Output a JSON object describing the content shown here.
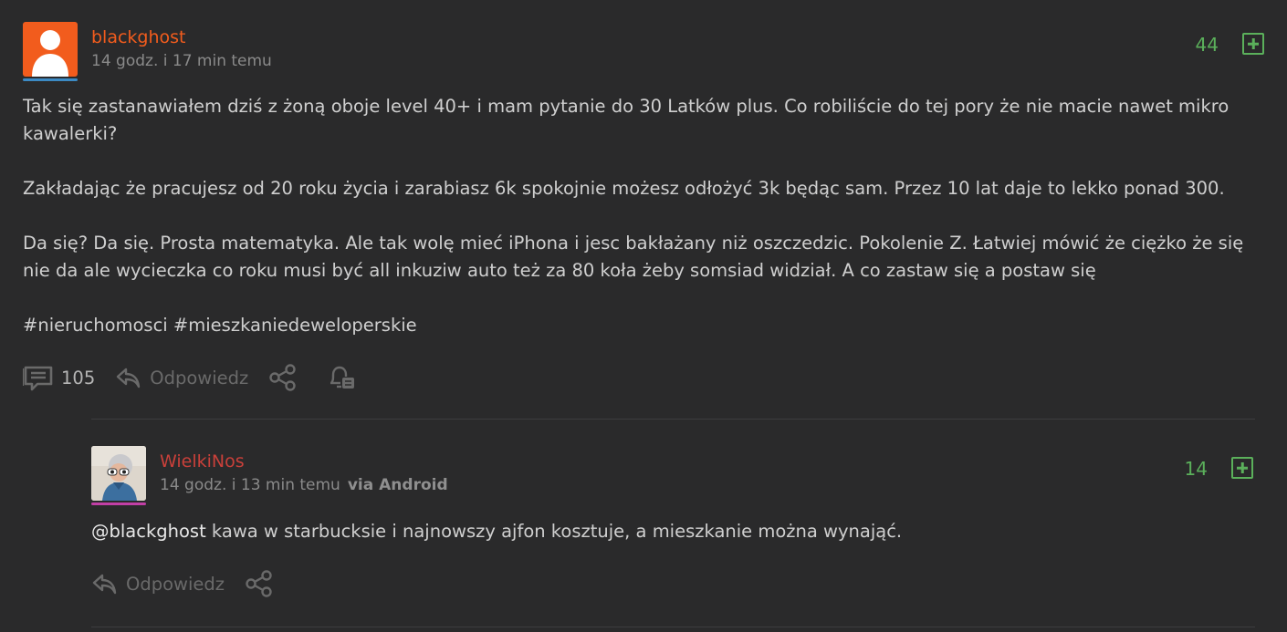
{
  "post": {
    "author": "blackghost",
    "author_color": "#f25c1d",
    "avatar_bar_color": "#3c8ac4",
    "timestamp": "14 godz. i 17 min temu",
    "votes": "44",
    "paragraphs": [
      "Tak się zastanawiałem dziś z żoną oboje level 40+ i mam pytanie do 30 Latków plus. Co robiliście do tej pory że nie macie nawet mikro kawalerki?",
      "",
      "Zakładając że pracujesz od 20 roku życia i zarabiasz 6k spokojnie możesz odłożyć 3k będąc sam. Przez 10 lat daje to lekko ponad 300.",
      "",
      "Da się? Da się. Prosta matematyka. Ale tak wolę mieć iPhona i jesc bakłażany niż oszczedzic. Pokolenie Z. Łatwiej mówić że ciężko że się nie da ale wycieczka co roku musi być all inkuziw auto też za 80 koła żeby somsiad widział. A co zastaw się a postaw się",
      "",
      "#nieruchomosci #mieszkaniedeweloperskie"
    ],
    "comments_count": "105",
    "reply_label": "Odpowiedz"
  },
  "comment": {
    "author": "WielkiNos",
    "author_color": "#c9403a",
    "avatar_bar_color": "#c23fa6",
    "timestamp": "14 godz. i 13 min temu",
    "via": "via Android",
    "votes": "14",
    "mention": "@blackghost",
    "text": " kawa w starbucksie i najnowszy ajfon kosztuje, a mieszkanie można wynająć.",
    "reply_label": "Odpowiedz"
  }
}
